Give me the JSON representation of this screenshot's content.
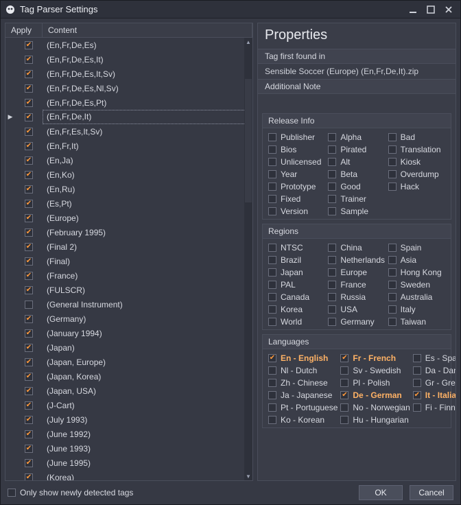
{
  "window": {
    "title": "Tag Parser Settings"
  },
  "columns": {
    "apply": "Apply",
    "content": "Content"
  },
  "rows": [
    {
      "apply": true,
      "content": "(En,Fr,De,Es)"
    },
    {
      "apply": true,
      "content": "(En,Fr,De,Es,It)"
    },
    {
      "apply": true,
      "content": "(En,Fr,De,Es,It,Sv)"
    },
    {
      "apply": true,
      "content": "(En,Fr,De,Es,Nl,Sv)"
    },
    {
      "apply": true,
      "content": "(En,Fr,De,Es,Pt)"
    },
    {
      "apply": true,
      "content": "(En,Fr,De,It)",
      "selected": true
    },
    {
      "apply": true,
      "content": "(En,Fr,Es,It,Sv)"
    },
    {
      "apply": true,
      "content": "(En,Fr,It)"
    },
    {
      "apply": true,
      "content": "(En,Ja)"
    },
    {
      "apply": true,
      "content": "(En,Ko)"
    },
    {
      "apply": true,
      "content": "(En,Ru)"
    },
    {
      "apply": true,
      "content": "(Es,Pt)"
    },
    {
      "apply": true,
      "content": "(Europe)"
    },
    {
      "apply": true,
      "content": "(February 1995)"
    },
    {
      "apply": true,
      "content": "(Final 2)"
    },
    {
      "apply": true,
      "content": "(Final)"
    },
    {
      "apply": true,
      "content": "(France)"
    },
    {
      "apply": true,
      "content": "(FULSCR)"
    },
    {
      "apply": false,
      "content": "(General Instrument)"
    },
    {
      "apply": true,
      "content": "(Germany)"
    },
    {
      "apply": true,
      "content": "(January 1994)"
    },
    {
      "apply": true,
      "content": "(Japan)"
    },
    {
      "apply": true,
      "content": "(Japan, Europe)"
    },
    {
      "apply": true,
      "content": "(Japan, Korea)"
    },
    {
      "apply": true,
      "content": "(Japan, USA)"
    },
    {
      "apply": true,
      "content": "(J-Cart)"
    },
    {
      "apply": true,
      "content": "(July 1993)"
    },
    {
      "apply": true,
      "content": "(June 1992)"
    },
    {
      "apply": true,
      "content": "(June 1993)"
    },
    {
      "apply": true,
      "content": "(June 1995)"
    },
    {
      "apply": true,
      "content": "(Korea)"
    }
  ],
  "properties": {
    "heading": "Properties",
    "tagFirstFoundLabel": "Tag first found in",
    "tagFirstFoundValue": "Sensible Soccer (Europe) (En,Fr,De,It).zip",
    "additionalNoteLabel": "Additional Note"
  },
  "sections": {
    "releaseInfo": {
      "title": "Release Info",
      "items": [
        {
          "label": "Publisher",
          "checked": false
        },
        {
          "label": "Bios",
          "checked": false
        },
        {
          "label": "Unlicensed",
          "checked": false
        },
        {
          "label": "Year",
          "checked": false
        },
        {
          "label": "Prototype",
          "checked": false
        },
        {
          "label": "Fixed",
          "checked": false
        },
        {
          "label": "Version",
          "checked": false
        },
        {
          "label": "Alpha",
          "checked": false
        },
        {
          "label": "Pirated",
          "checked": false
        },
        {
          "label": "Alt",
          "checked": false
        },
        {
          "label": "Beta",
          "checked": false
        },
        {
          "label": "Good",
          "checked": false
        },
        {
          "label": "Trainer",
          "checked": false
        },
        {
          "label": "Sample",
          "checked": false
        },
        {
          "label": "Bad",
          "checked": false
        },
        {
          "label": "Translation",
          "checked": false
        },
        {
          "label": "Kiosk",
          "checked": false
        },
        {
          "label": "Overdump",
          "checked": false
        },
        {
          "label": "Hack",
          "checked": false
        }
      ]
    },
    "regions": {
      "title": "Regions",
      "items": [
        {
          "label": "NTSC",
          "checked": false
        },
        {
          "label": "Brazil",
          "checked": false
        },
        {
          "label": "Japan",
          "checked": false
        },
        {
          "label": "PAL",
          "checked": false
        },
        {
          "label": "Canada",
          "checked": false
        },
        {
          "label": "Korea",
          "checked": false
        },
        {
          "label": "World",
          "checked": false
        },
        {
          "label": "China",
          "checked": false
        },
        {
          "label": "Netherlands",
          "checked": false
        },
        {
          "label": "Europe",
          "checked": false
        },
        {
          "label": "France",
          "checked": false
        },
        {
          "label": "Russia",
          "checked": false
        },
        {
          "label": "USA",
          "checked": false
        },
        {
          "label": "Germany",
          "checked": false
        },
        {
          "label": "Spain",
          "checked": false
        },
        {
          "label": "Asia",
          "checked": false
        },
        {
          "label": "Hong Kong",
          "checked": false
        },
        {
          "label": "Sweden",
          "checked": false
        },
        {
          "label": "Australia",
          "checked": false
        },
        {
          "label": "Italy",
          "checked": false
        },
        {
          "label": "Taiwan",
          "checked": false
        }
      ]
    },
    "languages": {
      "title": "Languages",
      "items": [
        {
          "label": "En - English",
          "checked": true
        },
        {
          "label": "Nl - Dutch",
          "checked": false
        },
        {
          "label": "Zh - Chinese",
          "checked": false
        },
        {
          "label": "Ja - Japanese",
          "checked": false
        },
        {
          "label": "Pt - Portuguese",
          "checked": false
        },
        {
          "label": "Ko - Korean",
          "checked": false
        },
        {
          "label": "Fr - French",
          "checked": true
        },
        {
          "label": "Sv - Swedish",
          "checked": false
        },
        {
          "label": "Pl - Polish",
          "checked": false
        },
        {
          "label": "De - German",
          "checked": true
        },
        {
          "label": "No - Norwegian",
          "checked": false
        },
        {
          "label": "Hu - Hungarian",
          "checked": false
        },
        {
          "label": "Es - Spanish",
          "checked": false
        },
        {
          "label": "Da - Danish",
          "checked": false
        },
        {
          "label": "Gr - Greek",
          "checked": false
        },
        {
          "label": "It - Italian",
          "checked": true
        },
        {
          "label": "Fi - Finnish",
          "checked": false
        }
      ]
    }
  },
  "footer": {
    "onlyNewLabel": "Only show newly detected tags",
    "onlyNewChecked": false,
    "ok": "OK",
    "cancel": "Cancel"
  }
}
